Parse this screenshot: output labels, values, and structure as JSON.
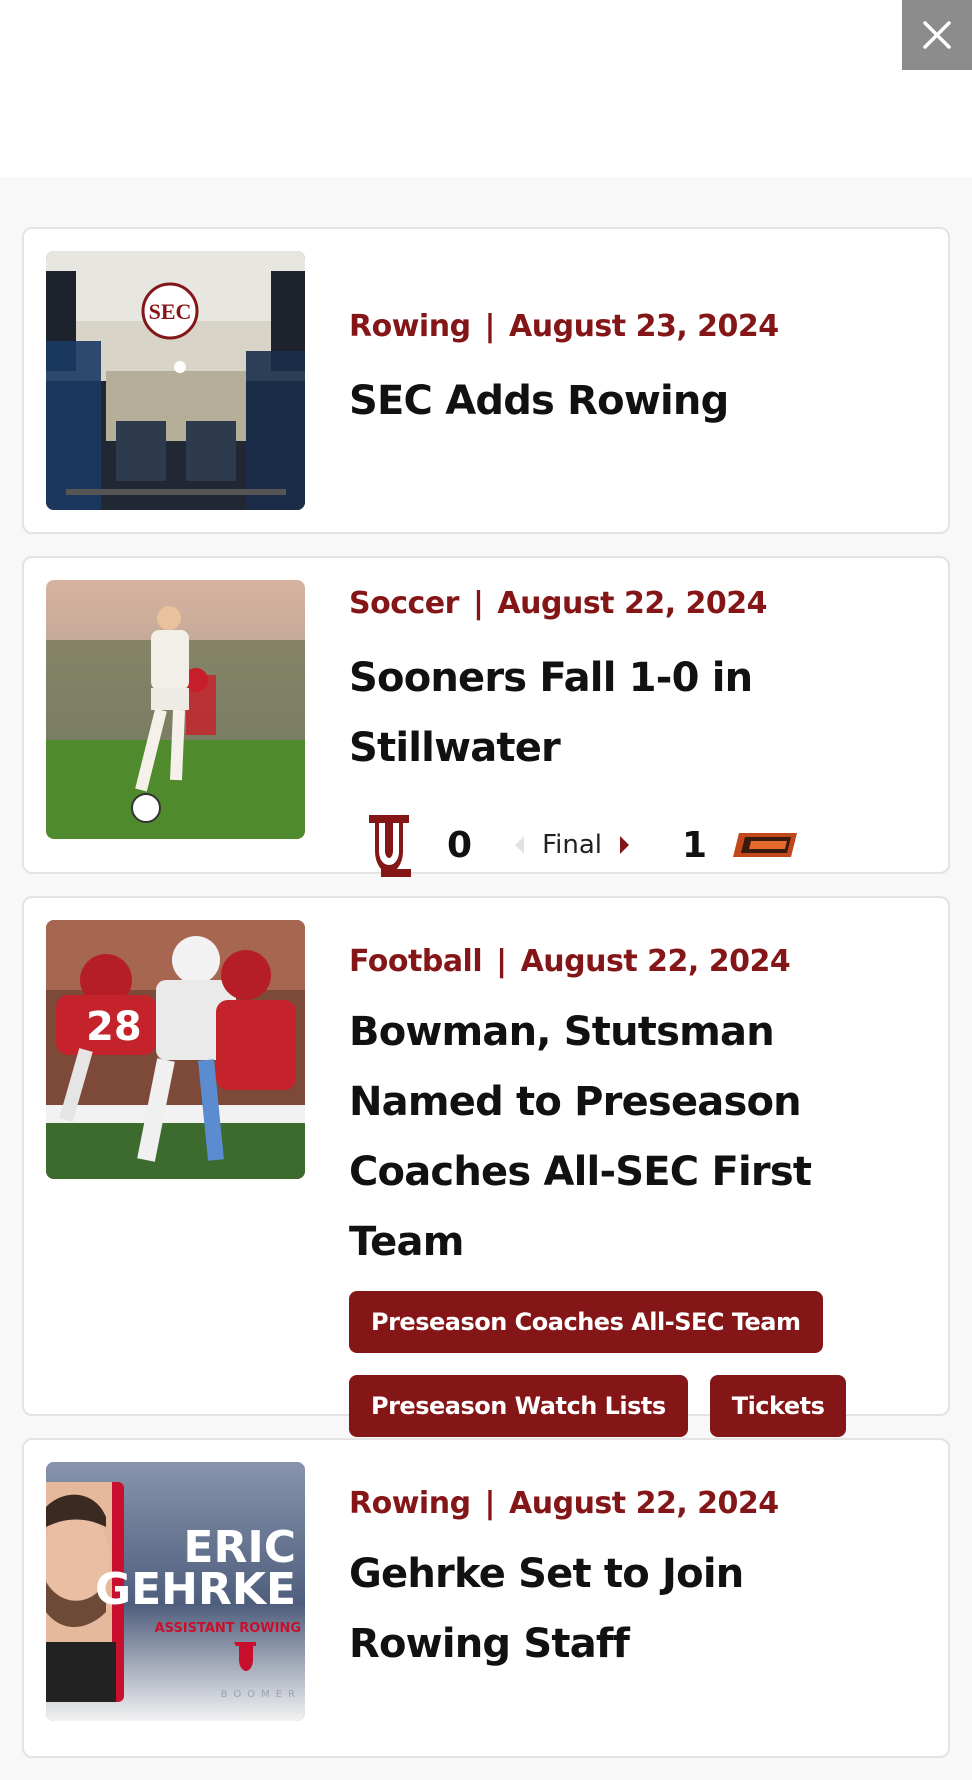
{
  "colors": {
    "accent": "#841617",
    "close_bg": "#8c8c8c"
  },
  "close_icon": "close-icon",
  "articles": [
    {
      "sport": "Rowing",
      "date": "August 23, 2024",
      "title": "SEC Adds Rowing",
      "image": "sec-rowing-gym-photo",
      "image_text": "SEC"
    },
    {
      "sport": "Soccer",
      "date": "August 22, 2024",
      "title": "Sooners Fall 1-0 in Stillwater",
      "image": "soccer-player-photo",
      "score": {
        "home_logo": "ou-logo-icon",
        "home_score": "0",
        "status": "Final",
        "away_score": "1",
        "away_logo": "osu-logo-icon"
      }
    },
    {
      "sport": "Football",
      "date": "August 22, 2024",
      "title": "Bowman, Stutsman Named to Preseason Coaches All-SEC First Team",
      "image": "football-tackle-photo",
      "tags": [
        "Preseason Coaches All-SEC Team",
        "Preseason Watch Lists",
        "Tickets"
      ]
    },
    {
      "sport": "Rowing",
      "date": "August 22, 2024",
      "title": "Gehrke Set to Join Rowing Staff",
      "image": "eric-gehrke-graphic",
      "image_text": {
        "line1": "ERIC",
        "line2": "GEHRKE",
        "role": "ASSISTANT ROWING",
        "brand": "BOOMER"
      }
    }
  ]
}
